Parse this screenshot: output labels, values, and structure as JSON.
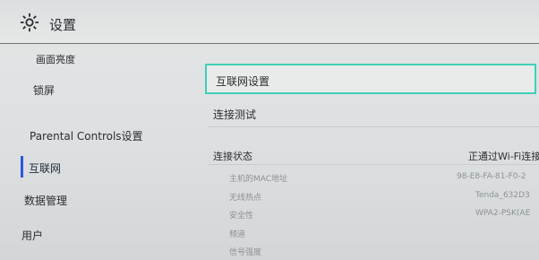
{
  "header": {
    "title": "设置",
    "icon": "gear-icon"
  },
  "sidebar": {
    "items": [
      {
        "label": "画面亮度"
      },
      {
        "label": "锁屏"
      },
      {
        "label": "Parental Controls设置"
      },
      {
        "label": "互联网",
        "active": true
      },
      {
        "label": "数据管理"
      },
      {
        "label": "用户"
      }
    ],
    "active_color": "#2d58d8"
  },
  "main": {
    "menu": [
      {
        "label": "互联网设置",
        "focused": true
      },
      {
        "label": "连接测试"
      }
    ],
    "focus_color": "#3fd0b8",
    "status": {
      "label": "连接状态",
      "value": "正通过Wi-Fi连接"
    },
    "details": [
      {
        "label": "主机的MAC地址",
        "value": "98-E8-FA-81-F0-2"
      },
      {
        "label": "无线热点",
        "value": "Tenda_632D3"
      },
      {
        "label": "安全性",
        "value": "WPA2-PSK(AE"
      },
      {
        "label": "频道",
        "value": ""
      },
      {
        "label": "信号强度",
        "value": ""
      }
    ]
  }
}
